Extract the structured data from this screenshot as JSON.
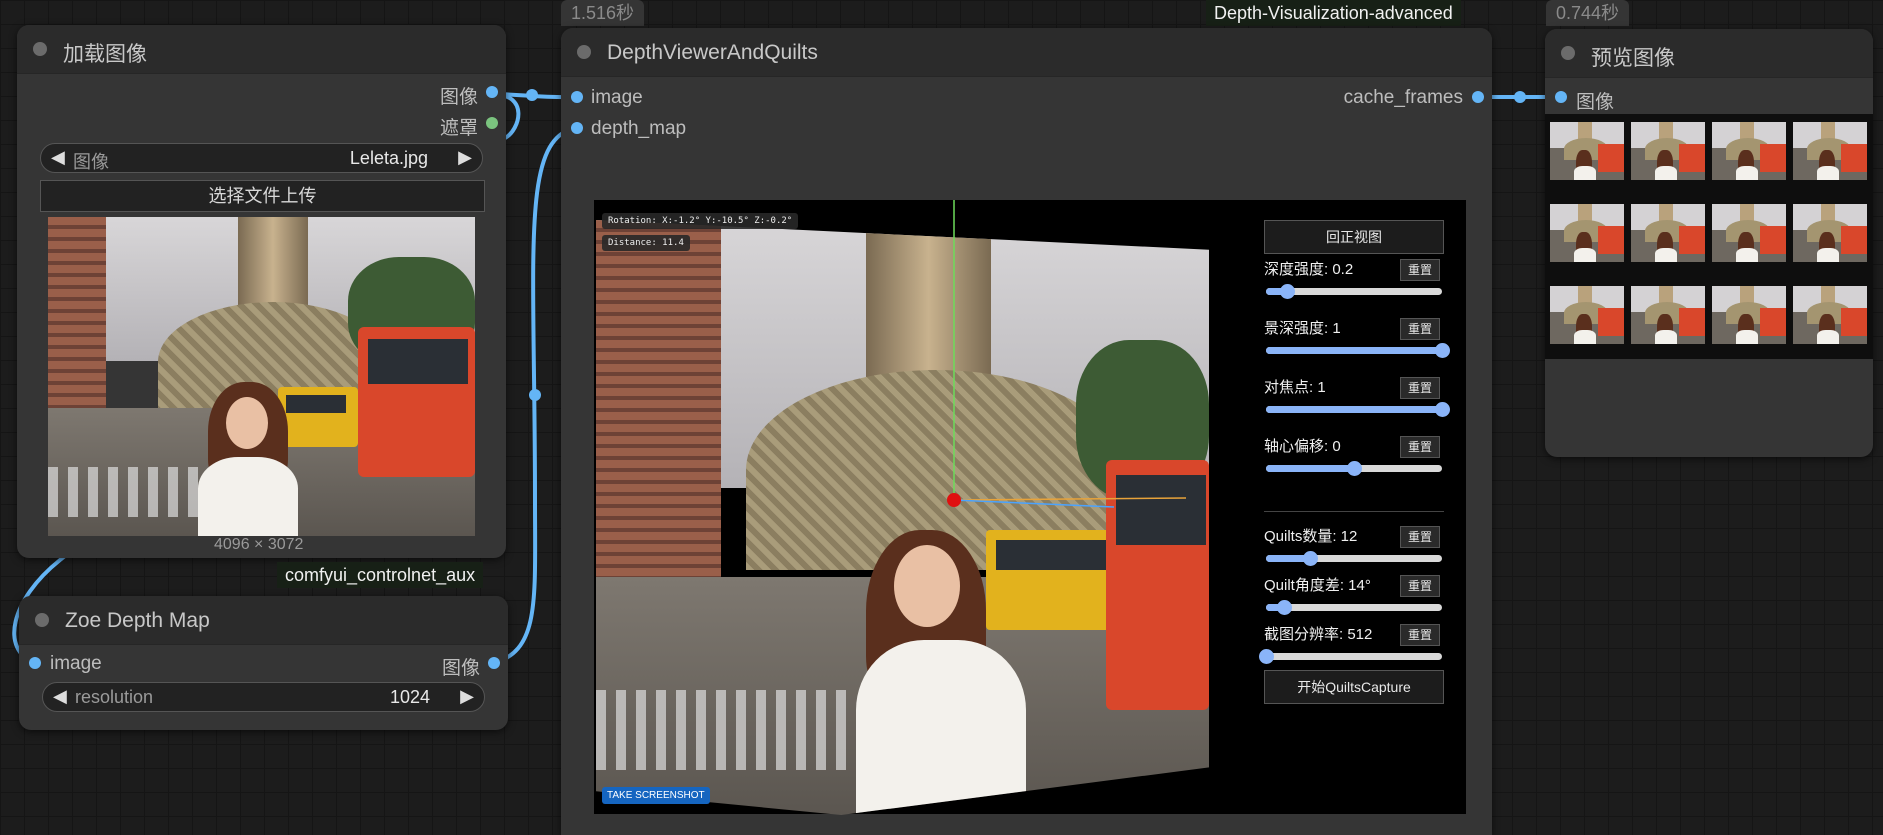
{
  "nodes": {
    "load_image": {
      "title": "加载图像",
      "outputs": [
        "图像",
        "遮罩"
      ],
      "image_widget": {
        "label": "图像",
        "value": "Leleta.jpg"
      },
      "upload_label": "选择文件上传",
      "dimensions": "4096 × 3072",
      "group_badge": "comfyui_controlnet_aux"
    },
    "zoe": {
      "title": "Zoe Depth Map",
      "input": "image",
      "output": "图像",
      "resolution_widget": {
        "label": "resolution",
        "value": "1024"
      }
    },
    "depth_viewer": {
      "timing": "1.516秒",
      "badge": "Depth-Visualization-advanced",
      "title": "DepthViewerAndQuilts",
      "inputs": [
        "image",
        "depth_map"
      ],
      "output": "cache_frames",
      "overlay": {
        "rotation": "Rotation: X:-1.2°  Y:-10.5°  Z:-0.2°",
        "distance": "Distance: 11.4"
      },
      "screenshot_label": "TAKE SCREENSHOT",
      "reset_view_label": "回正视图",
      "reset_label": "重置",
      "controls": [
        {
          "label": "深度强度: 0.2",
          "fraction": 0.12
        },
        {
          "label": "景深强度: 1",
          "fraction": 1.0
        },
        {
          "label": "对焦点: 1",
          "fraction": 1.0
        },
        {
          "label": "轴心偏移: 0",
          "fraction": 0.5
        },
        {
          "label": "Quilts数量: 12",
          "fraction": 0.25
        },
        {
          "label": "Quilt角度差: 14°",
          "fraction": 0.1
        },
        {
          "label": "截图分辨率: 512",
          "fraction": 0.0
        }
      ],
      "capture_label": "开始QuiltsCapture"
    },
    "preview": {
      "timing": "0.744秒",
      "title": "预览图像",
      "input": "图像"
    }
  },
  "colors": {
    "link_blue": "#64b5f6",
    "mask_green": "#7bc47f",
    "slider_blue": "#8ab4f8",
    "screenshot_blue": "#1565c0"
  }
}
